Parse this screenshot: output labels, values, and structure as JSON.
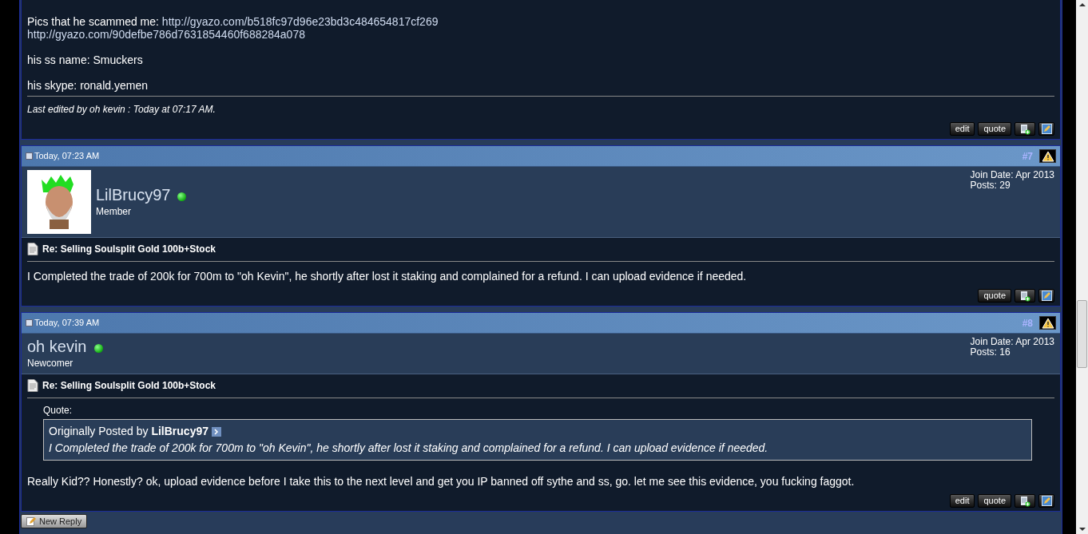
{
  "partial_post": {
    "body": [
      [
        [
          {
            "text": "Pics that he scammed me: ",
            "link": false
          },
          {
            "text": "http://gyazo.com/b518fc97d96e23bd3c484654817cf269",
            "link": true
          }
        ],
        [
          {
            "text": "http://gyazo.com/90defbe786d7631854460f688284a078",
            "link": true
          }
        ]
      ],
      [
        [
          {
            "text": "his ss name: Smuckers",
            "link": false
          }
        ]
      ],
      [
        [
          {
            "text": "his skype: ronald.yemen",
            "link": false
          }
        ]
      ]
    ],
    "edit_note": "Last edited by oh kevin : Today at 07:17 AM.",
    "buttons": [
      {
        "kind": "text",
        "label": "edit"
      },
      {
        "kind": "text",
        "label": "quote"
      },
      {
        "kind": "multiquote"
      },
      {
        "kind": "quick-reply"
      }
    ]
  },
  "posts": [
    {
      "date": "Today, 07:23 AM",
      "number": "#7",
      "online": true,
      "avatar": {
        "kind": "picture"
      },
      "username": "LilBrucy97",
      "rank": "Member",
      "join_date": "Join Date: Apr 2013",
      "post_count": "Posts: 29",
      "title": "Re: Selling Soulsplit Gold 100b+Stock",
      "body": "I Completed the trade of 200k for 700m to \"oh Kevin\", he shortly after lost it staking and complained for a refund. I can upload evidence if needed.",
      "buttons": [
        {
          "kind": "text",
          "label": "quote"
        },
        {
          "kind": "multiquote"
        },
        {
          "kind": "quick-reply"
        }
      ]
    },
    {
      "date": "Today, 07:39 AM",
      "number": "#8",
      "online": true,
      "username": "oh kevin",
      "rank": "Newcomer",
      "join_date": "Join Date: Apr 2013",
      "post_count": "Posts: 16",
      "title": "Re: Selling Soulsplit Gold 100b+Stock",
      "quote": {
        "label": "Quote:",
        "attribution": "Originally Posted by **LilBrucy97**",
        "text": "I Completed the trade of 200k for 700m to \"oh Kevin\", he shortly after lost it staking and complained for a refund. I can upload evidence if needed."
      },
      "body": "Really Kid?? Honestly? ok, upload evidence before I take this to the next level and get you IP banned off sythe and ss, go. let me see this evidence, you fucking faggot.",
      "buttons": [
        {
          "kind": "text",
          "label": "edit"
        },
        {
          "kind": "text",
          "label": "quote"
        },
        {
          "kind": "multiquote"
        },
        {
          "kind": "quick-reply"
        }
      ]
    }
  ],
  "new_reply": "New Reply"
}
